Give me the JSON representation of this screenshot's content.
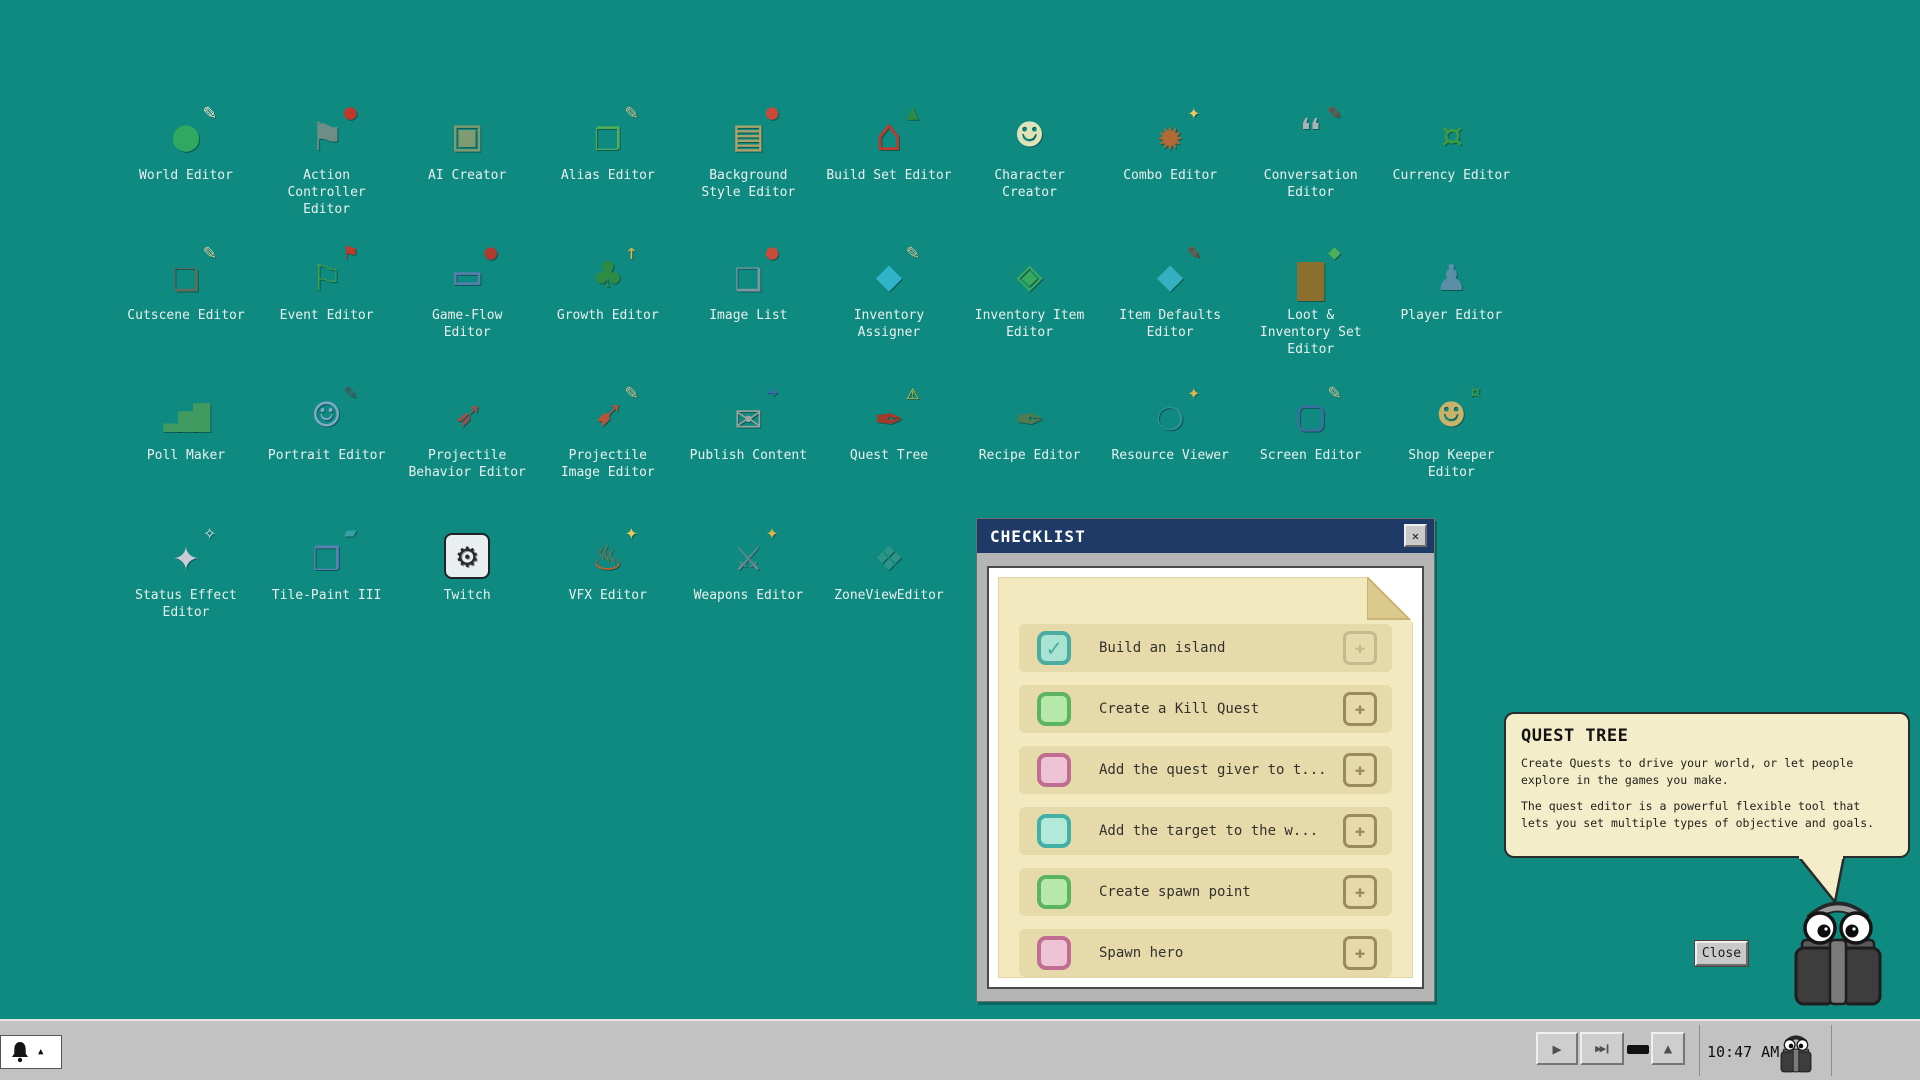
{
  "desktop": {
    "icons": [
      {
        "name": "world-editor",
        "label": "World Editor",
        "glyph": "●",
        "color": "#2fa962",
        "glyph2": "✎",
        "color2": "#f0ead2"
      },
      {
        "name": "action-controller-editor",
        "label": "Action\nController\nEditor",
        "glyph": "⚑",
        "color": "#6f8d87",
        "glyph2": "●",
        "color2": "#c0392b"
      },
      {
        "name": "ai-creator",
        "label": "AI Creator",
        "glyph": "▣",
        "color": "#7f9b72"
      },
      {
        "name": "alias-editor",
        "label": "Alias Editor",
        "glyph": "❐",
        "color": "#4fae57",
        "glyph2": "✎",
        "color2": "#cfc49a"
      },
      {
        "name": "background-style-editor",
        "label": "Background\nStyle Editor",
        "glyph": "▤",
        "color": "#a8a26b",
        "glyph2": "●",
        "color2": "#c74a3a"
      },
      {
        "name": "build-set-editor",
        "label": "Build Set Editor",
        "glyph": "⌂",
        "color": "#c0392b",
        "glyph2": "▲",
        "color2": "#2e8b44"
      },
      {
        "name": "character-creator",
        "label": "Character\nCreator",
        "glyph": "☻",
        "color": "#dfe3b9"
      },
      {
        "name": "combo-editor",
        "label": "Combo Editor",
        "glyph": "✹",
        "color": "#b46a32",
        "glyph2": "✦",
        "color2": "#e5c95c"
      },
      {
        "name": "conversation-editor",
        "label": "Conversation\nEditor",
        "glyph": "❝",
        "color": "#aab4b4",
        "glyph2": "✎",
        "color2": "#b03a2e"
      },
      {
        "name": "currency-editor",
        "label": "Currency Editor",
        "glyph": "¤",
        "color": "#3f9b42"
      },
      {
        "name": "cutscene-editor",
        "label": "Cutscene Editor",
        "glyph": "❏",
        "color": "#5d6f5d",
        "glyph2": "✎",
        "color2": "#d8cf9a"
      },
      {
        "name": "event-editor",
        "label": "Event Editor",
        "glyph": "⚐",
        "color": "#3e9e4f",
        "glyph2": "⚑",
        "color2": "#c0392b"
      },
      {
        "name": "game-flow-editor",
        "label": "Game-Flow\nEditor",
        "glyph": "▭",
        "color": "#5a7fae",
        "glyph2": "●",
        "color2": "#b03a2e"
      },
      {
        "name": "growth-editor",
        "label": "Growth Editor",
        "glyph": "♣",
        "color": "#2e8b44",
        "glyph2": "↑",
        "color2": "#d4b84a"
      },
      {
        "name": "image-list",
        "label": "Image List",
        "glyph": "❑",
        "color": "#7d98a3",
        "glyph2": "●",
        "color2": "#c74a3a"
      },
      {
        "name": "inventory-assigner",
        "label": "Inventory\nAssigner",
        "glyph": "◆",
        "color": "#2fb3c9",
        "glyph2": "✎",
        "color2": "#cfc49a"
      },
      {
        "name": "inventory-item-editor",
        "label": "Inventory Item\nEditor",
        "glyph": "◈",
        "color": "#3aa85a"
      },
      {
        "name": "item-defaults-editor",
        "label": "Item Defaults\nEditor",
        "glyph": "◆",
        "color": "#35b0c0",
        "glyph2": "✎",
        "color2": "#b03a2e"
      },
      {
        "name": "loot-inventory-set-editor",
        "label": "Loot &\nInventory Set\nEditor",
        "glyph": "▆",
        "color": "#8a6f2f",
        "glyph2": "◆",
        "color2": "#4fae57"
      },
      {
        "name": "player-editor",
        "label": "Player Editor",
        "glyph": "♟",
        "color": "#5b8fa8"
      },
      {
        "name": "poll-maker",
        "label": "Poll Maker",
        "glyph": "▂▅▇",
        "color": "#3f9b5f",
        "small": true
      },
      {
        "name": "portrait-editor",
        "label": "Portrait Editor",
        "glyph": "☺",
        "color": "#7fa8c9",
        "glyph2": "✎",
        "color2": "#555a5e"
      },
      {
        "name": "projectile-behavior-editor",
        "label": "Projectile\nBehavior Editor",
        "glyph": "➶",
        "color": "#9c4f4f"
      },
      {
        "name": "projectile-image-editor",
        "label": "Projectile\nImage Editor",
        "glyph": "➹",
        "color": "#b5533c",
        "glyph2": "✎",
        "color2": "#cfc49a"
      },
      {
        "name": "publish-content",
        "label": "Publish Content",
        "glyph": "✉",
        "color": "#9aa59f",
        "glyph2": "➔",
        "color2": "#3a6fae"
      },
      {
        "name": "quest-tree",
        "label": "Quest Tree",
        "glyph": "✒",
        "color": "#a33b2a",
        "glyph2": "⚠",
        "color2": "#f2c11e"
      },
      {
        "name": "recipe-editor",
        "label": "Recipe Editor",
        "glyph": "✒",
        "color": "#4f7a52"
      },
      {
        "name": "resource-viewer",
        "label": "Resource Viewer",
        "glyph": "❍",
        "color": "#2f8f98",
        "glyph2": "✦",
        "color2": "#d4b84a"
      },
      {
        "name": "screen-editor",
        "label": "Screen Editor",
        "glyph": "▢",
        "color": "#3c6e9f",
        "glyph2": "✎",
        "color2": "#cfc49a"
      },
      {
        "name": "shop-keeper-editor",
        "label": "Shop Keeper\nEditor",
        "glyph": "☻",
        "color": "#c9b26a",
        "glyph2": "¤",
        "color2": "#3f9b42"
      },
      {
        "name": "status-effect-editor",
        "label": "Status Effect\nEditor",
        "glyph": "✦",
        "color": "#c9ccd8",
        "glyph2": "✧",
        "color2": "#e0e3ea"
      },
      {
        "name": "tile-paint-iii",
        "label": "Tile-Paint III",
        "glyph": "❒",
        "color": "#5a7fb5",
        "glyph2": "▰",
        "color2": "#3aa0a8"
      },
      {
        "name": "twitch",
        "label": "Twitch",
        "glyph": "⚙",
        "color": "#2a2a2a",
        "box": true
      },
      {
        "name": "vfx-editor",
        "label": "VFX Editor",
        "glyph": "♨",
        "color": "#c06030",
        "glyph2": "✦",
        "color2": "#e5c95c"
      },
      {
        "name": "weapons-editor",
        "label": "Weapons Editor",
        "glyph": "⚔",
        "color": "#7a8a94",
        "glyph2": "✦",
        "color2": "#d4b84a"
      },
      {
        "name": "zone-view-editor",
        "label": "ZoneViewEditor",
        "glyph": "❖",
        "color": "#2f9488"
      }
    ]
  },
  "checklist": {
    "title": "CHECKLIST",
    "close_glyph": "✕",
    "plus_glyph": "✚",
    "check_glyph": "✓",
    "items": [
      {
        "label": "Build an island",
        "checked": true,
        "color": "teal",
        "plus_disabled": true
      },
      {
        "label": "Create a Kill Quest",
        "checked": false,
        "color": "green"
      },
      {
        "label": "Add the quest giver to t...",
        "checked": false,
        "color": "pink"
      },
      {
        "label": "Add the target to the w...",
        "checked": false,
        "color": "cyan"
      },
      {
        "label": "Create spawn point",
        "checked": false,
        "color": "green"
      },
      {
        "label": "Spawn hero",
        "checked": false,
        "color": "pink"
      }
    ]
  },
  "assistant": {
    "title": "QUEST TREE",
    "body_1": "Create Quests to drive your world, or let people explore in the games you make.",
    "body_2": "The quest editor is a powerful flexible tool that lets you set multiple types of objective and goals.",
    "close_label": "Close",
    "mascot": "binoculars-character"
  },
  "taskbar": {
    "time": "10:47 AM",
    "play_glyph": "▶",
    "skip_glyph": "▶▶❙",
    "eject_glyph": "▲",
    "bell_caret_glyph": "▲"
  },
  "colors": {
    "desktop_bg": "#0e8a80",
    "titlebar_bg": "#1f3a66",
    "window_frame": "#b5b5b5",
    "note_bg": "#f3e9be",
    "note_fold": "#dcc98c",
    "row_bg": "#e6daab",
    "bubble_bg": "#f3edca",
    "taskbar_bg": "#c2c2c2",
    "plus_normal": "#9b8a5e",
    "plus_disabled": "#c6b98d",
    "checkbox": {
      "teal": {
        "border": "#4aada0",
        "fill": "#a9e4d2"
      },
      "green": {
        "border": "#5cb461",
        "fill": "#b5e8a9"
      },
      "pink": {
        "border": "#c06d92",
        "fill": "#efc3d6"
      },
      "cyan": {
        "border": "#43b0a6",
        "fill": "#b2ead9"
      }
    }
  }
}
